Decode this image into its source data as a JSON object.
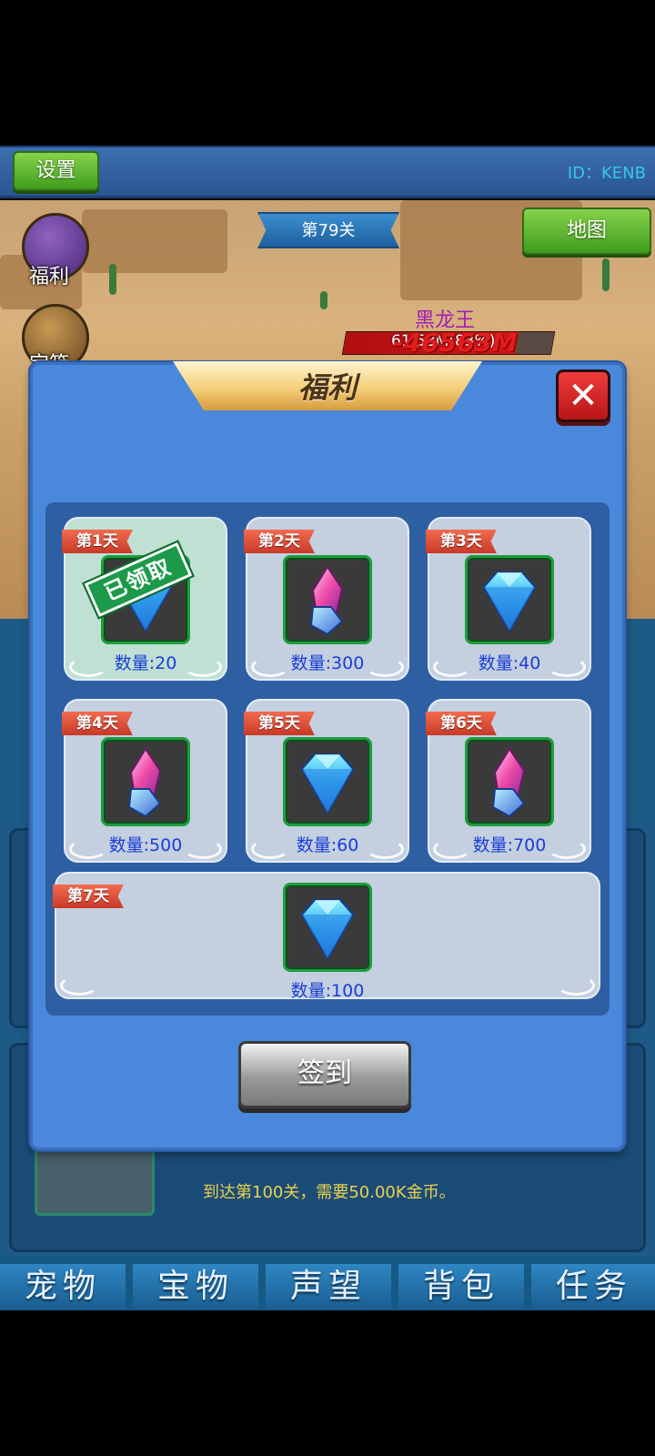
{
  "header": {
    "settings_label": "设置",
    "id_label": "ID：KENB"
  },
  "stage": {
    "label": "第79关"
  },
  "map_button": {
    "label": "地图"
  },
  "side_menu": [
    {
      "label": "福利",
      "icon": "gift-icon"
    },
    {
      "label": "宝箱",
      "icon": "treasure-chest-icon"
    }
  ],
  "boss": {
    "name": "黑龙王",
    "hp_text": "61.58M(83%)",
    "damage_text": "-46563M",
    "hp_percent": 83
  },
  "modal": {
    "title": "福利",
    "close_icon": "close-icon",
    "claimed_stamp": "已领取",
    "rewards": [
      {
        "day": "第1天",
        "item": "diamond",
        "quantity": "数量:20",
        "claimed": true
      },
      {
        "day": "第2天",
        "item": "crystal",
        "quantity": "数量:300",
        "claimed": false
      },
      {
        "day": "第3天",
        "item": "diamond",
        "quantity": "数量:40",
        "claimed": false
      },
      {
        "day": "第4天",
        "item": "crystal",
        "quantity": "数量:500",
        "claimed": false
      },
      {
        "day": "第5天",
        "item": "diamond",
        "quantity": "数量:60",
        "claimed": false
      },
      {
        "day": "第6天",
        "item": "crystal",
        "quantity": "数量:700",
        "claimed": false
      },
      {
        "day": "第7天",
        "item": "diamond",
        "quantity": "数量:100",
        "claimed": false
      }
    ],
    "signin_label": "签到"
  },
  "upgrade": {
    "text": "到达第100关，需要50.00K金币。"
  },
  "bottom_nav": [
    {
      "label": "宠物"
    },
    {
      "label": "宝物"
    },
    {
      "label": "声望"
    },
    {
      "label": "背包"
    },
    {
      "label": "任务"
    }
  ],
  "colors": {
    "modal_bg": "#4a88dc",
    "quantity_text": "#1a3ed6",
    "day_ribbon": "#e0513b",
    "green_button": "#5fb832"
  }
}
